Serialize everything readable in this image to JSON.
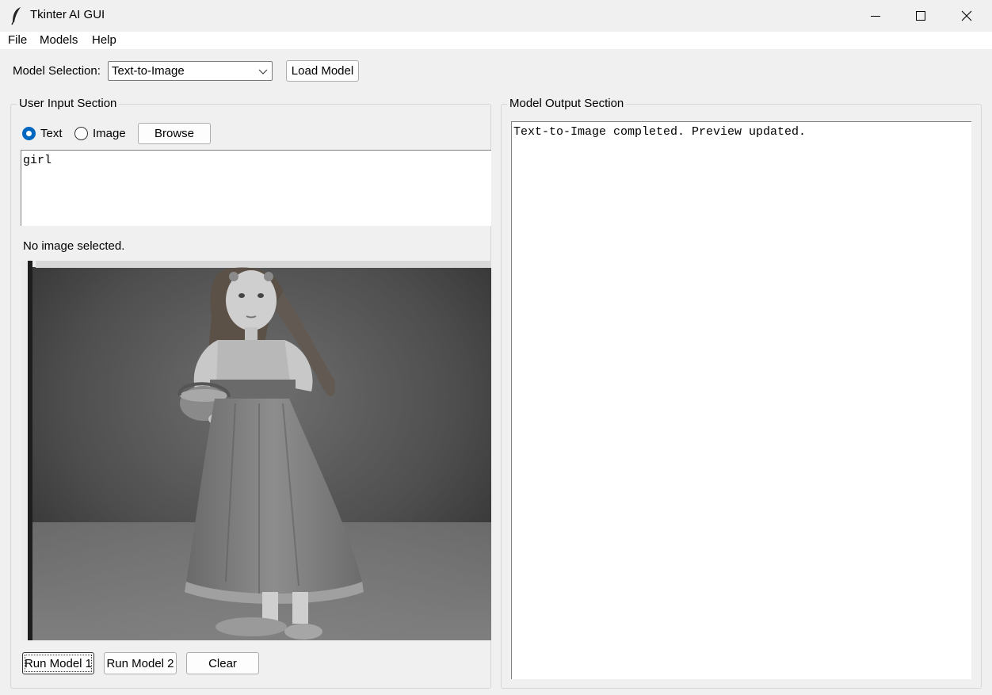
{
  "window": {
    "title": "Tkinter AI GUI"
  },
  "menu": {
    "items": [
      "File",
      "Models",
      "Help"
    ]
  },
  "toolbar": {
    "model_selection_label": "Model Selection:",
    "model_selected": "Text-to-Image",
    "load_model_label": "Load Model"
  },
  "input_section": {
    "title": "User Input Section",
    "radio_text_label": "Text",
    "radio_image_label": "Image",
    "selected_input_type": "Text",
    "browse_label": "Browse",
    "text_value": "girl",
    "image_status": "No image selected.",
    "run_model_1_label": "Run Model 1",
    "run_model_2_label": "Run Model 2",
    "clear_label": "Clear"
  },
  "output_section": {
    "title": "Model Output Section",
    "text": "Text-to-Image completed. Preview updated."
  },
  "icons": {
    "app": "feather-icon",
    "minimize": "minimize-icon",
    "maximize": "maximize-icon",
    "close": "close-icon",
    "dropdown": "chevron-down-icon"
  },
  "colors": {
    "radio_accent": "#0067c0",
    "window_bg": "#f0f0f0"
  }
}
